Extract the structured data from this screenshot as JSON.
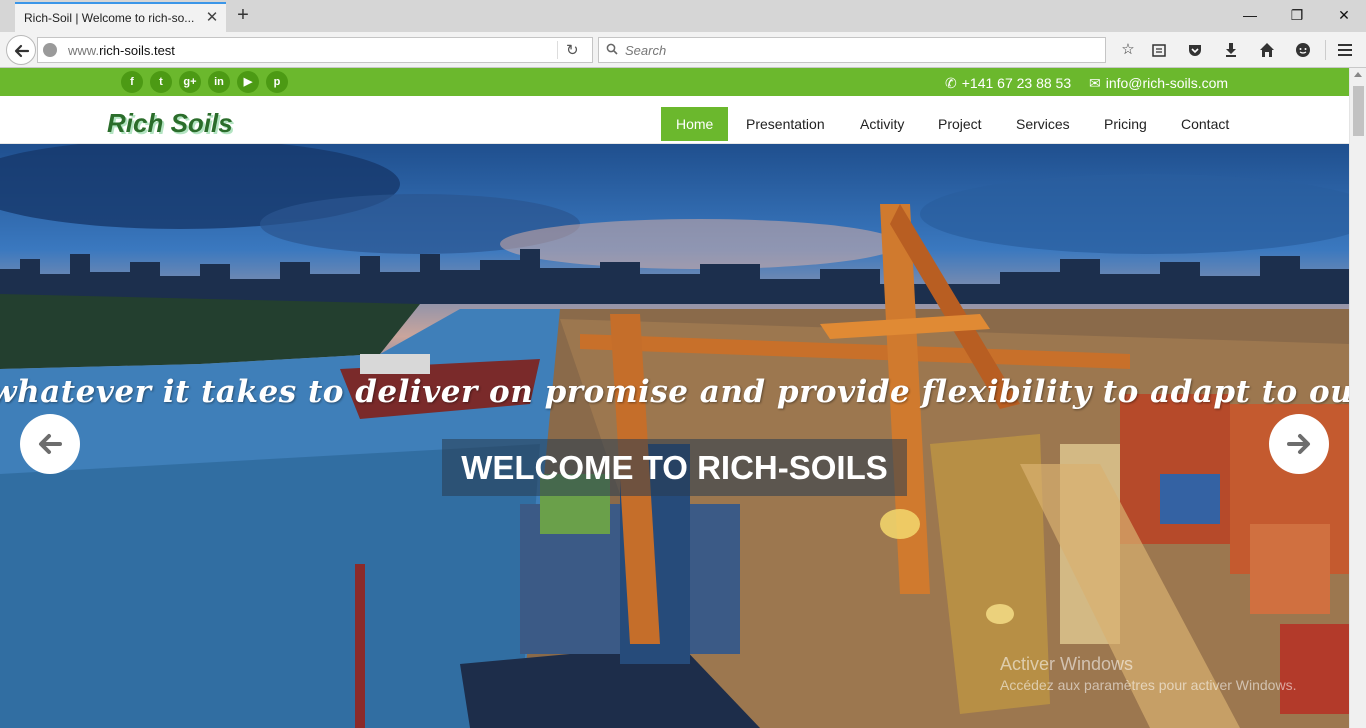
{
  "browser": {
    "tab_title": "Rich-Soil | Welcome to rich-so...",
    "tab_close": "✕",
    "new_tab": "+",
    "url_prefix": "www.",
    "url_host": "rich-soils.test",
    "search_placeholder": "Search",
    "window_buttons": {
      "minimize": "—",
      "maximize": "❐",
      "close": "✕"
    },
    "toolbar_icons": [
      "star-icon",
      "reading-list-icon",
      "pocket-icon",
      "download-icon",
      "home-icon",
      "chat-icon",
      "menu-icon"
    ]
  },
  "site": {
    "social": [
      {
        "name": "facebook",
        "glyph": "f"
      },
      {
        "name": "twitter",
        "glyph": "t"
      },
      {
        "name": "google-plus",
        "glyph": "g+"
      },
      {
        "name": "linkedin",
        "glyph": "in"
      },
      {
        "name": "youtube",
        "glyph": "▶"
      },
      {
        "name": "pinterest",
        "glyph": "p"
      }
    ],
    "phone_icon": "✆",
    "phone": "+141 67 23 88 53",
    "email_icon": "✉",
    "email": "info@rich-soils.com",
    "logo": "Rich Soils",
    "menu": [
      "Home",
      "Presentation",
      "Activity",
      "Project",
      "Services",
      "Pricing",
      "Contact"
    ],
    "active_menu": "Home",
    "hero": {
      "tagline": "whatever it takes to deliver on promise and provide flexibility to adapt to our customers",
      "title": "WELCOME TO RICH-SOILS"
    },
    "watermark": {
      "line1": "Activer Windows",
      "line2": "Accédez aux paramètres pour activer Windows."
    }
  },
  "colors": {
    "brand_green": "#6bb82d",
    "logo_green": "#2b6d2b",
    "tab_accent": "#3b96e8"
  }
}
